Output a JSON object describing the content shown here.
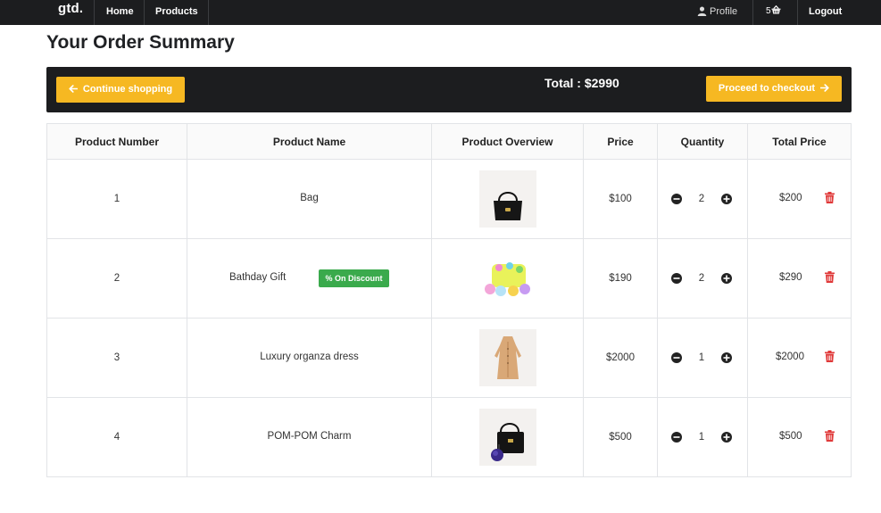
{
  "nav": {
    "brand": "gtd.",
    "home": "Home",
    "products": "Products",
    "profile": "Profile",
    "cart_count": "5",
    "logout": "Logout"
  },
  "page": {
    "title": "Your Order Summary"
  },
  "summary": {
    "continue_label": "Continue shopping",
    "total_label": "Total : $2990",
    "checkout_label": "Proceed to checkout"
  },
  "table": {
    "headers": [
      "Product Number",
      "Product Name",
      "Product Overview",
      "Price",
      "Quantity",
      "Total Price"
    ],
    "rows": [
      {
        "number": "1",
        "name": "Bag",
        "badge": "",
        "image": "black-handbag",
        "price": "$100",
        "qty": "2",
        "total": "$200"
      },
      {
        "number": "2",
        "name": "Bathday Gift",
        "badge": "% On Discount",
        "image": "bath-bombs-gift",
        "price": "$190",
        "qty": "2",
        "total": "$290"
      },
      {
        "number": "3",
        "name": "Luxury organza dress",
        "badge": "",
        "image": "beige-dress",
        "price": "$2000",
        "qty": "1",
        "total": "$2000"
      },
      {
        "number": "4",
        "name": "POM-POM Charm",
        "badge": "",
        "image": "bag-with-pompom",
        "price": "$500",
        "qty": "1",
        "total": "$500"
      }
    ]
  },
  "colors": {
    "navbar": "#1c1d1f",
    "accent": "#f6b822",
    "badge": "#3aaa4c",
    "delete": "#e03a3a"
  }
}
